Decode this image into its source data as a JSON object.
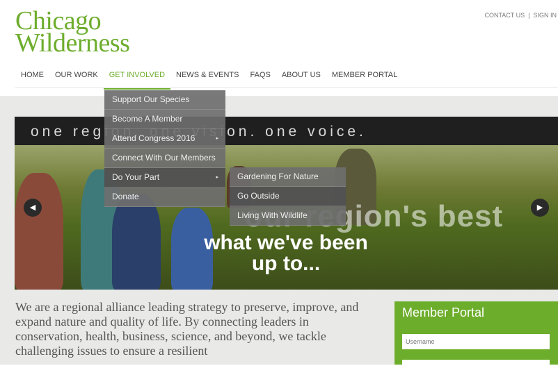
{
  "logo": {
    "line1": "Chicago",
    "line2": "Wilderness"
  },
  "toplinks": {
    "contact": "CONTACT US",
    "sep": "|",
    "signin": "SIGN IN"
  },
  "nav": [
    {
      "label": "HOME"
    },
    {
      "label": "OUR WORK"
    },
    {
      "label": "GET INVOLVED"
    },
    {
      "label": "NEWS & EVENTS"
    },
    {
      "label": "FAQS"
    },
    {
      "label": "ABOUT US"
    },
    {
      "label": "MEMBER PORTAL"
    }
  ],
  "dropdown": [
    {
      "label": "Support Our Species"
    },
    {
      "label": "Become A Member"
    },
    {
      "label": "Attend Congress 2016",
      "caret": "▸"
    },
    {
      "label": "Connect With Our Members"
    },
    {
      "label": "Do Your Part",
      "caret": "▸"
    },
    {
      "label": "Donate"
    }
  ],
  "submenu": [
    {
      "label": "Gardening For Nature"
    },
    {
      "label": "Go Outside"
    },
    {
      "label": "Living With Wildlife"
    }
  ],
  "hero": {
    "tagline": "one region. one vision. one voice.",
    "text1": "our region's best",
    "text2a": "what we've been",
    "text2b": "up to...",
    "prev": "◀",
    "next": "▶"
  },
  "intro": "We are a regional alliance leading strategy to preserve, improve, and expand nature and quality of life. By connecting leaders in conservation, health, business, science, and beyond, we tackle challenging issues to ensure a resilient",
  "portal": {
    "title": "Member Portal",
    "username_placeholder": "Username"
  },
  "colors": {
    "accent": "#6dad2c",
    "dropdown": "#6e6e6e",
    "tagbar": "#1f1f1f"
  }
}
